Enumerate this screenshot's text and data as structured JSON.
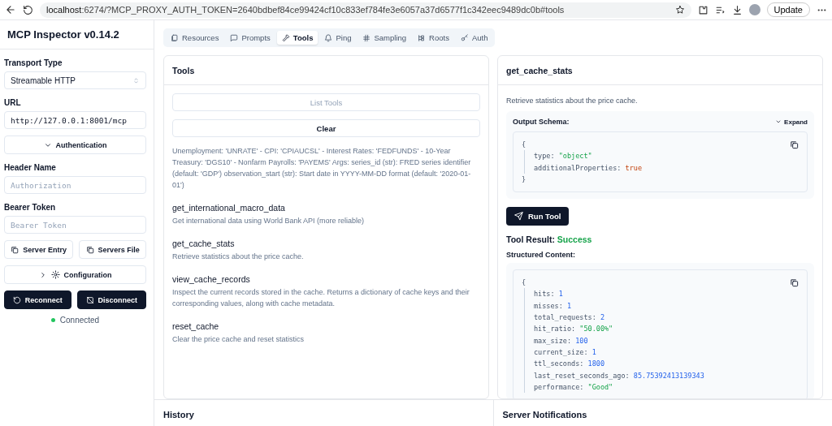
{
  "browser": {
    "url_host": "localhost",
    "url_rest": ":6274/?MCP_PROXY_AUTH_TOKEN=2640bdbef84ce99424cf10c833ef784fe3e6057a37d6577f1c342eec9489dc0b#tools",
    "update_button": "Update"
  },
  "sidebar": {
    "title": "MCP Inspector v0.14.2",
    "transport_label": "Transport Type",
    "transport_value": "Streamable HTTP",
    "url_label": "URL",
    "url_value": "http://127.0.0.1:8001/mcp",
    "auth_button": "Authentication",
    "header_name_label": "Header Name",
    "header_name_placeholder": "Authorization",
    "bearer_label": "Bearer Token",
    "bearer_placeholder": "Bearer Token",
    "server_entry_button": "Server Entry",
    "servers_file_button": "Servers File",
    "configuration_button": "Configuration",
    "reconnect_button": "Reconnect",
    "disconnect_button": "Disconnect",
    "status": {
      "label": "Connected",
      "connected": true
    }
  },
  "tabs": [
    {
      "label": "Resources",
      "selected": false
    },
    {
      "label": "Prompts",
      "selected": false
    },
    {
      "label": "Tools",
      "selected": true
    },
    {
      "label": "Ping",
      "selected": false
    },
    {
      "label": "Sampling",
      "selected": false
    },
    {
      "label": "Roots",
      "selected": false
    },
    {
      "label": "Auth",
      "selected": false
    }
  ],
  "tools_panel": {
    "title": "Tools",
    "list_button": {
      "label": "List Tools",
      "disabled": true
    },
    "clear_button": {
      "label": "Clear",
      "disabled": false
    },
    "tools": [
      {
        "description": "Unemployment: 'UNRATE' - CPI: 'CPIAUCSL' - Interest Rates: 'FEDFUNDS' - 10-Year Treasury: 'DGS10' - Nonfarm Payrolls: 'PAYEMS' Args: series_id (str): FRED series identifier (default: 'GDP') observation_start (str): Start date in YYYY-MM-DD format (default: '2020-01-01')"
      },
      {
        "name": "get_international_macro_data",
        "description": "Get international data using World Bank API (more reliable)"
      },
      {
        "name": "get_cache_stats",
        "description": "Retrieve statistics about the price cache."
      },
      {
        "name": "view_cache_records",
        "description": "Inspect the current records stored in the cache. Returns a dictionary of cache keys and their corresponding values, along with cache metadata."
      },
      {
        "name": "reset_cache",
        "description": "Clear the price cache and reset statistics"
      }
    ]
  },
  "detail": {
    "title": "get_cache_stats",
    "description": "Retrieve statistics about the price cache.",
    "output_schema": {
      "label": "Output Schema:",
      "expand": "Expand",
      "open": "{",
      "close": "}",
      "lines": [
        {
          "key": "type:",
          "value": "\"object\"",
          "kind": "string"
        },
        {
          "key": "additionalProperties:",
          "value": "true",
          "kind": "boolean"
        }
      ]
    },
    "run_button": "Run Tool",
    "result_label": "Tool Result:",
    "result_status": "Success",
    "structured_label": "Structured Content:",
    "content": {
      "open": "{",
      "lines": [
        {
          "key": "hits:",
          "value": "1",
          "kind": "number"
        },
        {
          "key": "misses:",
          "value": "1",
          "kind": "number"
        },
        {
          "key": "total_requests:",
          "value": "2",
          "kind": "number"
        },
        {
          "key": "hit_ratio:",
          "value": "\"50.00%\"",
          "kind": "string"
        },
        {
          "key": "max_size:",
          "value": "100",
          "kind": "number"
        },
        {
          "key": "current_size:",
          "value": "1",
          "kind": "number"
        },
        {
          "key": "ttl_seconds:",
          "value": "1800",
          "kind": "number"
        },
        {
          "key": "last_reset_seconds_ago:",
          "value": "85.75392413139343",
          "kind": "number"
        },
        {
          "key": "performance:",
          "value": "\"Good\"",
          "kind": "string"
        }
      ]
    }
  },
  "history": {
    "title": "History"
  },
  "notifications": {
    "title": "Server Notifications"
  }
}
